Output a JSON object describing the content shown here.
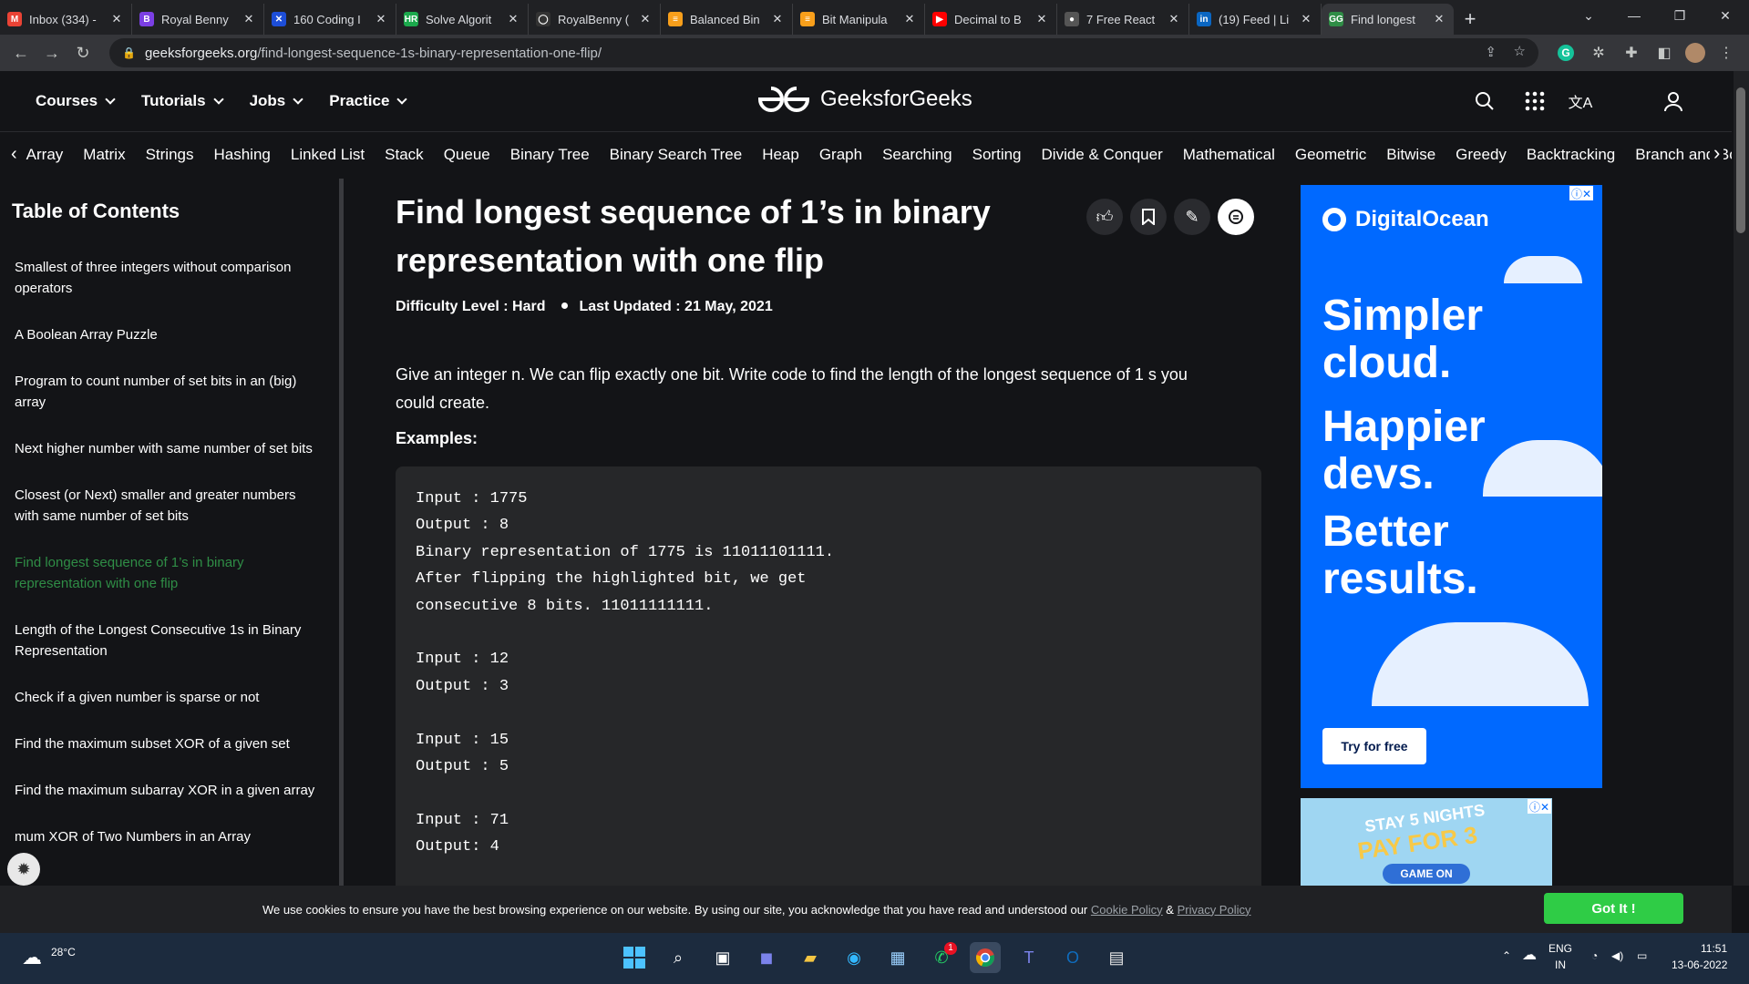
{
  "browser": {
    "tabs": [
      {
        "label": "Inbox (334) -",
        "favicon": "M",
        "color": "#ea4335"
      },
      {
        "label": "Royal Benny",
        "favicon": "B",
        "color": "#7b3fe4"
      },
      {
        "label": "160 Coding I",
        "favicon": "✕",
        "color": "#1d4ed8"
      },
      {
        "label": "Solve Algorit",
        "favicon": "HR",
        "color": "#1ba94c"
      },
      {
        "label": "RoyalBenny (",
        "favicon": "◯",
        "color": "#333333"
      },
      {
        "label": "Balanced Bin",
        "favicon": "≡",
        "color": "#f89f1b"
      },
      {
        "label": "Bit Manipula",
        "favicon": "≡",
        "color": "#f89f1b"
      },
      {
        "label": "Decimal to B",
        "favicon": "▶",
        "color": "#ff0000"
      },
      {
        "label": "7 Free React",
        "favicon": "●",
        "color": "#555555"
      },
      {
        "label": "(19) Feed | Li",
        "favicon": "in",
        "color": "#0a66c2"
      },
      {
        "label": "Find longest",
        "favicon": "GG",
        "color": "#2f8d46"
      }
    ],
    "url_host": "geeksforgeeks.org",
    "url_path": "/find-longest-sequence-1s-binary-representation-one-flip/"
  },
  "header": {
    "nav": [
      "Courses",
      "Tutorials",
      "Jobs",
      "Practice"
    ],
    "logo_text": "GeeksforGeeks"
  },
  "topics": [
    "Array",
    "Matrix",
    "Strings",
    "Hashing",
    "Linked List",
    "Stack",
    "Queue",
    "Binary Tree",
    "Binary Search Tree",
    "Heap",
    "Graph",
    "Searching",
    "Sorting",
    "Divide & Conquer",
    "Mathematical",
    "Geometric",
    "Bitwise",
    "Greedy",
    "Backtracking",
    "Branch and Bo"
  ],
  "sidebar": {
    "title": "Table of Contents",
    "items": [
      "Smallest of three integers without comparison operators",
      "A Boolean Array Puzzle",
      "Program to count number of set bits in an (big) array",
      "Next higher number with same number of set bits",
      "Closest (or Next) smaller and greater numbers with same number of set bits",
      "Find longest sequence of 1’s in binary representation with one flip",
      "Length of the Longest Consecutive 1s in Binary Representation",
      "Check if a given number is sparse or not",
      "Find the maximum subset XOR of a given set",
      "Find the maximum subarray XOR in a given array",
      "mum XOR of Two Numbers in an Array"
    ]
  },
  "article": {
    "title": "Find longest sequence of 1’s in binary representation with one flip",
    "difficulty": "Difficulty Level : Hard",
    "updated": "Last Updated : 21 May, 2021",
    "description": "Give an integer n. We can flip exactly one bit. Write code to find the length of the longest sequence of 1 s you could create.",
    "examples_heading": "Examples:",
    "code": "Input : 1775\nOutput : 8\nBinary representation of 1775 is 11011101111.\nAfter flipping the highlighted bit, we get\nconsecutive 8 bits. 11011111111.\n\nInput : 12\nOutput : 3\n\nInput : 15\nOutput : 5\n\nInput : 71\nOutput: 4"
  },
  "ads": {
    "brand": "DigitalOcean",
    "slogan": [
      "Simpler",
      "cloud.",
      "Happier",
      "devs.",
      "Better",
      "results."
    ],
    "cta": "Try for free",
    "ad2_line1": "STAY 5 NIGHTS",
    "ad2_line2": "PAY FOR 3",
    "ad2_button": "GAME ON"
  },
  "cookie": {
    "text": "We use cookies to ensure you have the best browsing experience on our website. By using our site, you acknowledge that you have read and understood our",
    "cookie_policy": "Cookie Policy",
    "amp": "&",
    "privacy_policy": "Privacy Policy",
    "button": "Got It !"
  },
  "taskbar": {
    "weather": "28°C",
    "lang1": "ENG",
    "lang2": "IN",
    "time": "11:51",
    "date": "13-06-2022",
    "whatsapp_badge": "1"
  }
}
